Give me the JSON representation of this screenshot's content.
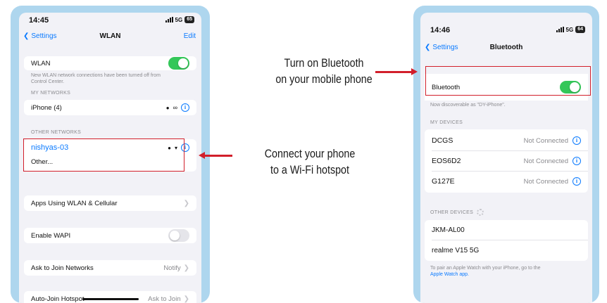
{
  "left_phone": {
    "status": {
      "time": "14:45",
      "network": "5G",
      "battery": "65"
    },
    "nav": {
      "back": "Settings",
      "title": "WLAN",
      "edit": "Edit"
    },
    "wlan_row": {
      "label": "WLAN",
      "toggle": "on"
    },
    "wlan_note": "New WLAN network connections have been turned off from Control Center.",
    "my_networks_header": "MY NETWORKS",
    "my_network": "iPhone (4)",
    "other_networks_header": "OTHER NETWORKS",
    "other_network": "nishyas-03",
    "other_label": "Other...",
    "apps_row": "Apps Using WLAN & Cellular",
    "wapi_row": {
      "label": "Enable WAPI",
      "toggle": "off"
    },
    "ask_row": {
      "label": "Ask to Join Networks",
      "value": "Notify"
    },
    "autojoin_row": {
      "label": "Auto-Join Hotspot",
      "value": "Ask to Join"
    }
  },
  "right_phone": {
    "status": {
      "time": "14:46",
      "network": "5G",
      "battery": "64"
    },
    "nav": {
      "back": "Settings",
      "title": "Bluetooth"
    },
    "bt_row": {
      "label": "Bluetooth",
      "toggle": "on"
    },
    "discoverable_note": "Now discoverable as \"DY-iPhone\".",
    "my_devices_header": "MY DEVICES",
    "devices": [
      {
        "name": "DCGS",
        "status": "Not Connected"
      },
      {
        "name": "EOS6D2",
        "status": "Not Connected"
      },
      {
        "name": "G127E",
        "status": "Not Connected"
      }
    ],
    "other_devices_header": "OTHER DEVICES",
    "other_devices": [
      "JKM-AL00",
      "realme V15 5G"
    ],
    "watch_note": "To pair an Apple Watch with your iPhone, go to the",
    "watch_link": "Apple Watch app."
  },
  "annotations": {
    "bluetooth_line1": "Turn on Bluetooth",
    "bluetooth_line2": "on your mobile phone",
    "wifi_line1": "Connect your phone",
    "wifi_line2": "to a Wi-Fi hotspot"
  },
  "colors": {
    "accent": "#0a7aff",
    "toggle_on": "#34c759",
    "highlight_box": "#d21f2b",
    "phone_frame": "#aed6ee"
  }
}
